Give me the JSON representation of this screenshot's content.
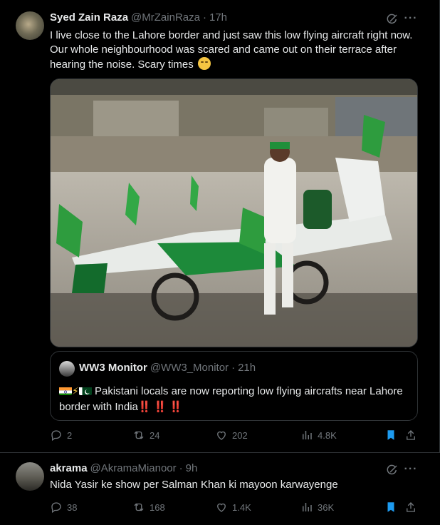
{
  "tweet1": {
    "name": "Syed Zain Raza",
    "handle": "@MrZainRaza",
    "dot": "·",
    "time": "17h",
    "more": "···",
    "text": "I live close to the Lahore border and just saw this low flying aircraft right now. Our whole neighbourhood was scared and came out on their terrace after hearing the noise. Scary times",
    "emoji": "smiling-face-icon",
    "quote": {
      "name": "WW3 Monitor",
      "handle": "@WW3_Monitor",
      "dot": "·",
      "time": "21h",
      "text": "Pakistani locals are now reporting low flying aircrafts near Lahore border with India",
      "bangs": [
        "‼️",
        "‼️",
        "‼️"
      ]
    },
    "stats": {
      "replies": "2",
      "reposts": "24",
      "likes": "202",
      "views": "4.8K"
    }
  },
  "tweet2": {
    "name": "akrama",
    "handle": "@AkramaMianoor",
    "dot": "·",
    "time": "9h",
    "more": "···",
    "text": "Nida Yasir ke show per Salman Khan ki mayoon karwayenge",
    "stats": {
      "replies": "38",
      "reposts": "168",
      "likes": "1.4K",
      "views": "36K"
    }
  },
  "colors": {
    "background": "#000000",
    "text": "#e7e9ea",
    "muted": "#71767b",
    "border": "#2f3336",
    "accent": "#1d9bf0",
    "flag_green": "#0f7a2e"
  }
}
